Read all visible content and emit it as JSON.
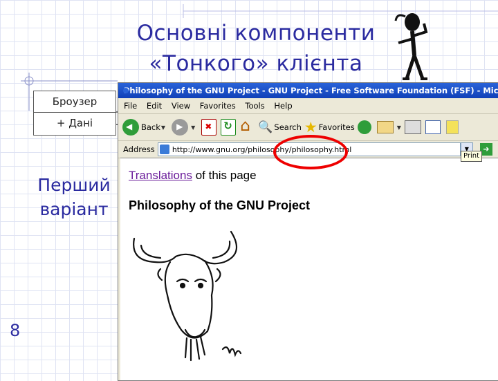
{
  "slide": {
    "title_line1": "Основні компоненти",
    "title_line2": "«Тонкого» клієнта",
    "uml_box": {
      "name": "Броузер",
      "attribute": "+ Дані"
    },
    "variant_line1": "Перший",
    "variant_line2": "варіант",
    "slide_number": "8"
  },
  "browser": {
    "window_title": "Philosophy of the GNU Project - GNU Project - Free Software Foundation (FSF) - Microsoft Internet Explorer",
    "menu": [
      "File",
      "Edit",
      "View",
      "Favorites",
      "Tools",
      "Help"
    ],
    "toolbar": {
      "back": "Back",
      "search": "Search",
      "favorites": "Favorites"
    },
    "address_label": "Address",
    "address_value": "http://www.gnu.org/philosophy/philosophy.html",
    "tooltip": "Print"
  },
  "page": {
    "translations_link": "Translations",
    "translations_rest": " of this page",
    "heading": "Philosophy of the GNU Project"
  },
  "colors": {
    "title": "#2b2ba0",
    "highlight": "#e00000",
    "ie_titlebar": "#2a63d8",
    "link_visited": "#6a1b9a"
  },
  "icons": [
    "stick-figure-icon",
    "back-icon",
    "forward-icon",
    "stop-icon",
    "refresh-icon",
    "home-icon",
    "search-icon",
    "favorites-star-icon",
    "history-icon",
    "mail-icon",
    "print-icon",
    "edit-icon",
    "messenger-icon",
    "go-icon",
    "gnu-head-icon"
  ]
}
